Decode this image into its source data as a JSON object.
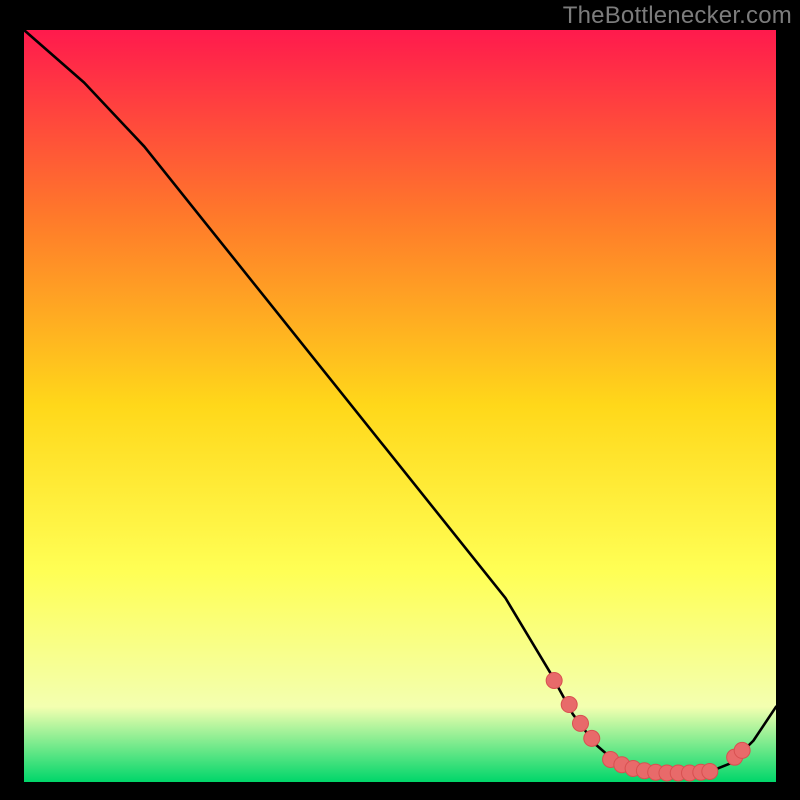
{
  "watermark": "TheBottlenecker.com",
  "colors": {
    "background": "#000000",
    "gradient_top": "#ff1a4d",
    "gradient_mid_upper": "#ff7a2a",
    "gradient_mid": "#ffd81a",
    "gradient_mid_lower": "#ffff55",
    "gradient_lower": "#f3ffb0",
    "gradient_bottom": "#00d66a",
    "curve": "#000000",
    "marker_fill": "#e86a6a",
    "marker_stroke": "#d85050"
  },
  "chart_data": {
    "type": "line",
    "title": "",
    "xlabel": "",
    "ylabel": "",
    "xlim": [
      0,
      100
    ],
    "ylim": [
      0,
      100
    ],
    "series": [
      {
        "name": "bottleneck-curve",
        "x": [
          0,
          8,
          16,
          24,
          32,
          40,
          48,
          56,
          64,
          70,
          73,
          76,
          79,
          82,
          85,
          88,
          91,
          94,
          97,
          100
        ],
        "y": [
          100,
          93,
          84.5,
          74.5,
          64.5,
          54.5,
          44.5,
          34.5,
          24.5,
          14.5,
          9,
          5,
          2.4,
          1.4,
          1.2,
          1.2,
          1.3,
          2.5,
          5.5,
          10
        ]
      }
    ],
    "markers": {
      "name": "highlighted-points",
      "x": [
        70.5,
        72.5,
        74,
        75.5,
        78,
        79.5,
        81,
        82.5,
        84,
        85.5,
        87,
        88.5,
        90,
        91.2,
        94.5,
        95.5
      ],
      "y": [
        13.5,
        10.3,
        7.8,
        5.8,
        3.0,
        2.3,
        1.8,
        1.5,
        1.3,
        1.2,
        1.2,
        1.2,
        1.3,
        1.4,
        3.3,
        4.2
      ]
    }
  }
}
